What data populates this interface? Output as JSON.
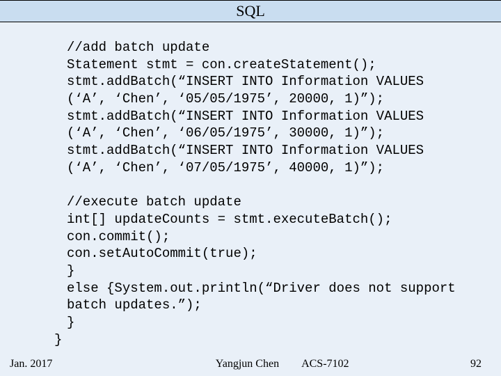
{
  "title": "SQL",
  "code": {
    "l1": "//add batch update",
    "l2": "Statement stmt = con.createStatement();",
    "l3": "stmt.addBatch(“INSERT INTO Information VALUES",
    "l4": "(‘A’, ‘Chen’, ‘05/05/1975’, 20000, 1)”);",
    "l5": "stmt.addBatch(“INSERT INTO Information VALUES",
    "l6": "(‘A’, ‘Chen’, ‘06/05/1975’, 30000, 1)”);",
    "l7": "stmt.addBatch(“INSERT INTO Information VALUES",
    "l8": "(‘A’, ‘Chen’, ‘07/05/1975’, 40000, 1)”);",
    "blank": "",
    "l9": "//execute batch update",
    "l10": "int[] updateCounts = stmt.executeBatch();",
    "l11": "con.commit();",
    "l12": "con.setAutoCommit(true);",
    "l13": "}",
    "l14": "else {System.out.println(“Driver does not support",
    "l15": "batch updates.”);",
    "l16": "}",
    "l17": "}"
  },
  "footer": {
    "date": "Jan. 2017",
    "author": "Yangjun Chen",
    "course": "ACS-7102",
    "page": "92"
  }
}
